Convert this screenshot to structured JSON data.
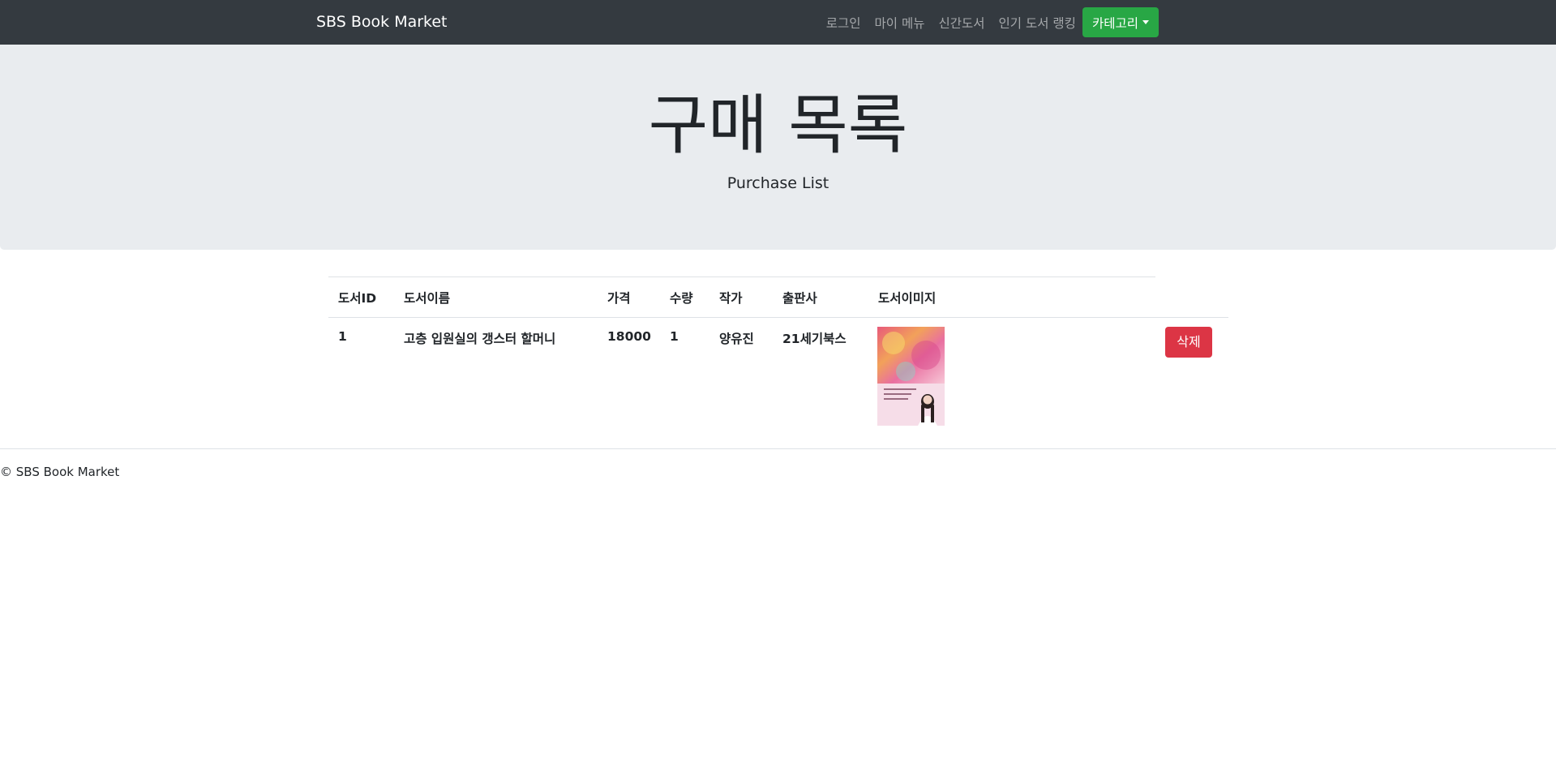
{
  "navbar": {
    "brand": "SBS Book Market",
    "links": [
      "로그인",
      "마이 메뉴",
      "신간도서",
      "인기 도서 랭킹"
    ],
    "category_button": "카테고리"
  },
  "jumbotron": {
    "title": "구매 목록",
    "subtitle": "Purchase List"
  },
  "table": {
    "headers": [
      "도서ID",
      "도서이름",
      "가격",
      "수량",
      "작가",
      "출판사",
      "도서이미지"
    ],
    "rows": [
      {
        "id": "1",
        "name": "고층 입원실의 갱스터 할머니",
        "price": "18000",
        "quantity": "1",
        "author": "양유진",
        "publisher": "21세기북스",
        "delete_label": "삭제"
      }
    ]
  },
  "footer": {
    "text": "© SBS Book Market"
  },
  "colors": {
    "navbar_bg": "#343a40",
    "category_button_bg": "#28a745",
    "delete_button_bg": "#dc3545",
    "jumbotron_bg": "#e9ecef"
  }
}
